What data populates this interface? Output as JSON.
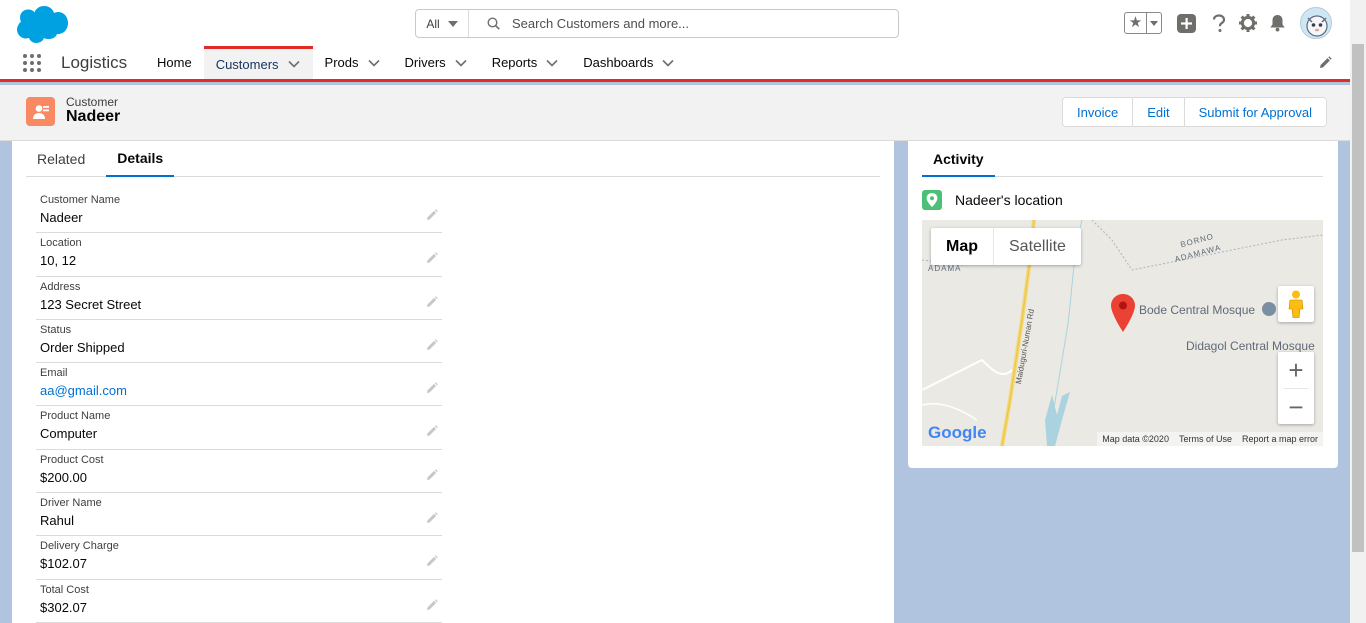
{
  "header": {
    "search_scope": "All",
    "search_placeholder": "Search Customers and more...",
    "icons": [
      "favorites-star-icon",
      "add-icon",
      "help-icon",
      "setup-gear-icon",
      "notifications-bell-icon"
    ]
  },
  "nav": {
    "app_name": "Logistics",
    "items": [
      {
        "label": "Home",
        "has_menu": false
      },
      {
        "label": "Customers",
        "has_menu": true,
        "active": true
      },
      {
        "label": "Prods",
        "has_menu": true
      },
      {
        "label": "Drivers",
        "has_menu": true
      },
      {
        "label": "Reports",
        "has_menu": true
      },
      {
        "label": "Dashboards",
        "has_menu": true
      }
    ]
  },
  "record": {
    "type": "Customer",
    "name": "Nadeer",
    "actions": [
      "Invoice",
      "Edit",
      "Submit for Approval"
    ]
  },
  "tabs": [
    "Related",
    "Details"
  ],
  "fields": [
    {
      "label": "Customer Name",
      "value": "Nadeer"
    },
    {
      "label": "Location",
      "value": "10, 12"
    },
    {
      "label": "Address",
      "value": "123 Secret Street"
    },
    {
      "label": "Status",
      "value": "Order Shipped"
    },
    {
      "label": "Email",
      "value": "aa@gmail.com",
      "link": true
    },
    {
      "label": "Product Name",
      "value": "Computer"
    },
    {
      "label": "Product Cost",
      "value": "$200.00"
    },
    {
      "label": "Driver Name",
      "value": "Rahul"
    },
    {
      "label": "Delivery Charge",
      "value": "$102.07"
    },
    {
      "label": "Total Cost",
      "value": "$302.07"
    }
  ],
  "activity": {
    "tab": "Activity",
    "location_title": "Nadeer's location",
    "map": {
      "type_map": "Map",
      "type_satellite": "Satellite",
      "place_1": "Bode Central Mosque",
      "place_2": "Didagol Central Mosque",
      "region_1": "BORNO",
      "region_2": "ADAMAWA",
      "region_3": "ADAMA",
      "road": "Maiduguri-Numan Rd",
      "logo": "Google",
      "footer": [
        "Map data ©2020",
        "Terms of Use",
        "Report a map error"
      ]
    }
  },
  "colors": {
    "accent_red": "#e02b27",
    "link_blue": "#0070d2",
    "record_icon": "#f88962",
    "location_icon": "#4bc076",
    "background": "#b0c4df"
  }
}
